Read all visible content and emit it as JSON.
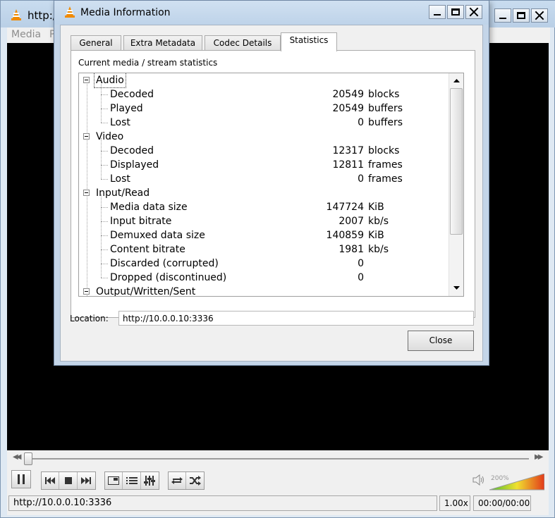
{
  "vlc": {
    "title": "http:/",
    "menu": [
      "Media",
      "P"
    ],
    "status_url": "http://10.0.0.10:3336",
    "speed": "1.00x",
    "time": "00:00/00:00",
    "volume_pct": "200%",
    "seek_position": 0.0
  },
  "dialog": {
    "title": "Media Information",
    "tabs": [
      {
        "label": "General"
      },
      {
        "label": "Extra Metadata"
      },
      {
        "label": "Codec Details"
      },
      {
        "label": "Statistics"
      }
    ],
    "active_tab": "Statistics",
    "panel_caption": "Current media / stream statistics",
    "tree": [
      {
        "category": "Audio",
        "items": [
          {
            "label": "Decoded",
            "value": "20549",
            "unit": "blocks"
          },
          {
            "label": "Played",
            "value": "20549",
            "unit": "buffers"
          },
          {
            "label": "Lost",
            "value": "0",
            "unit": "buffers"
          }
        ]
      },
      {
        "category": "Video",
        "items": [
          {
            "label": "Decoded",
            "value": "12317",
            "unit": "blocks"
          },
          {
            "label": "Displayed",
            "value": "12811",
            "unit": "frames"
          },
          {
            "label": "Lost",
            "value": "0",
            "unit": "frames"
          }
        ]
      },
      {
        "category": "Input/Read",
        "items": [
          {
            "label": "Media data size",
            "value": "147724",
            "unit": "KiB"
          },
          {
            "label": "Input bitrate",
            "value": "2007",
            "unit": "kb/s"
          },
          {
            "label": "Demuxed data size",
            "value": "140859",
            "unit": "KiB"
          },
          {
            "label": "Content bitrate",
            "value": "1981",
            "unit": "kb/s"
          },
          {
            "label": "Discarded (corrupted)",
            "value": "0",
            "unit": ""
          },
          {
            "label": "Dropped (discontinued)",
            "value": "0",
            "unit": ""
          }
        ]
      },
      {
        "category": "Output/Written/Sent",
        "items": []
      }
    ],
    "location_label": "Location:",
    "location_value": "http://10.0.0.10:3336",
    "close_label": "Close"
  },
  "colors": {
    "title_bar": "#c9dcef",
    "video_bg": "#000000",
    "vlc_orange": "#f08a00"
  }
}
